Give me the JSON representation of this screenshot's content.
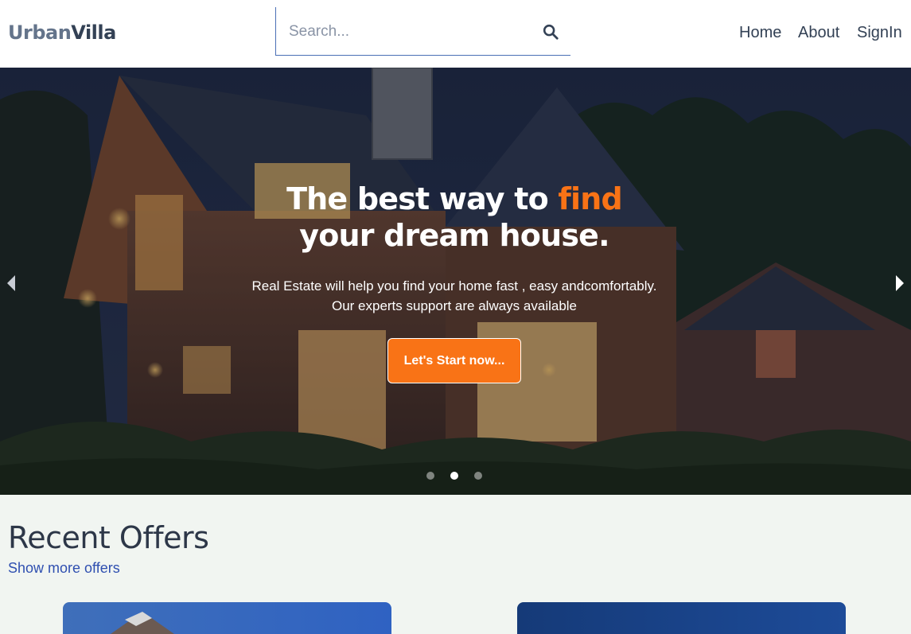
{
  "header": {
    "logo_part1": "Urban",
    "logo_part2": "Villa",
    "search_placeholder": "Search...",
    "search_icon": "search-icon",
    "nav": [
      "Home",
      "About",
      "SignIn"
    ]
  },
  "hero": {
    "title_part1": "The best way to ",
    "title_accent": "find",
    "title_line2": "your dream house.",
    "subtitle_line1": "Real Estate will help you find your home fast , easy andcomfortably.",
    "subtitle_line2": "Our experts support are always available",
    "cta_label": "Let's Start now...",
    "prev_icon": "chevron-left-icon",
    "next_icon": "chevron-right-icon",
    "slide_count": 3,
    "active_slide_index": 1
  },
  "offers": {
    "title": "Recent Offers",
    "link": "Show more offers"
  },
  "colors": {
    "accent": "#f97316",
    "text_dark": "#334155",
    "link": "#2f4fb0",
    "page_bg": "#f1f5f1"
  }
}
